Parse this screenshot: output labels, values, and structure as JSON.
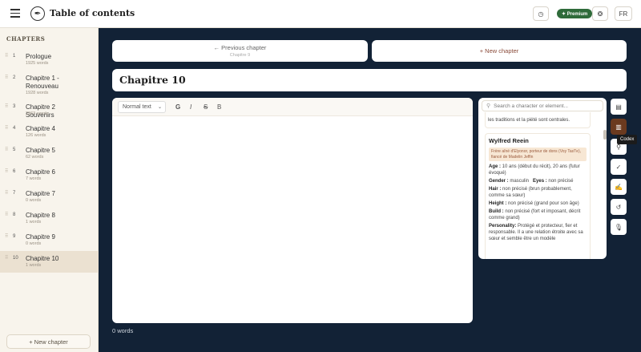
{
  "header": {
    "title": "Table of contents",
    "premium_label": "✦ Premium",
    "lang": "FR"
  },
  "sidebar": {
    "heading": "CHAPTERS",
    "new_chapter": "+ New chapter",
    "chapters": [
      {
        "num": "1",
        "title": "Prologue",
        "words": "1925 words"
      },
      {
        "num": "2",
        "title": "Chapitre 1 - Renouveau",
        "words": "1928 words"
      },
      {
        "num": "3",
        "title": "Chapitre 2 Souvenirs",
        "words": "2963 words"
      },
      {
        "num": "4",
        "title": "Chapitre 4",
        "words": "126 words"
      },
      {
        "num": "5",
        "title": "Chapitre 5",
        "words": "62 words"
      },
      {
        "num": "6",
        "title": "Chapitre 6",
        "words": "7 words"
      },
      {
        "num": "7",
        "title": "Chapitre 7",
        "words": "0 words"
      },
      {
        "num": "8",
        "title": "Chapitre 8",
        "words": "1 words"
      },
      {
        "num": "9",
        "title": "Chapitre 9",
        "words": "0 words"
      },
      {
        "num": "10",
        "title": "Chapitre 10",
        "words": "1 words"
      }
    ]
  },
  "main": {
    "prev_label": "← Previous chapter",
    "prev_sub": "Chapitre 9",
    "new_label": "+ New chapter",
    "chapter_title": "Chapitre 10",
    "word_count": "0 words"
  },
  "editor": {
    "style": "Normal text",
    "bold": "G",
    "italic": "I",
    "strike": "S",
    "extra": "B"
  },
  "codex": {
    "search_placeholder": "Search a character or element...",
    "prev_card_text": "les traditions et la piété sont centrales.",
    "card": {
      "name": "Wylfred Reein",
      "tag": "Frère aîné d'Elyonor, porteur de dons (Voy Tas'l'e), fiancé de Madelin Jeffin",
      "age_label": "Age :",
      "age": "10 ans (début du récit), 20 ans (futur évoqué)",
      "gender_label": "Gender :",
      "gender": "masculin",
      "eyes_label": "Eyes :",
      "eyes": "non précisé",
      "hair_label": "Hair :",
      "hair": "non précisé (brun probablement, comme sa sœur)",
      "height_label": "Height :",
      "height": "non précisé (grand pour son âge)",
      "build_label": "Build :",
      "build": "non précisé (fort et imposant, décrit comme grand)",
      "personality_label": "Personality:",
      "personality": "Protégé et protecteur, fier et responsable. Il a une relation étroite avec sa sœur et semble être un modèle"
    },
    "tooltip": "Codex"
  }
}
